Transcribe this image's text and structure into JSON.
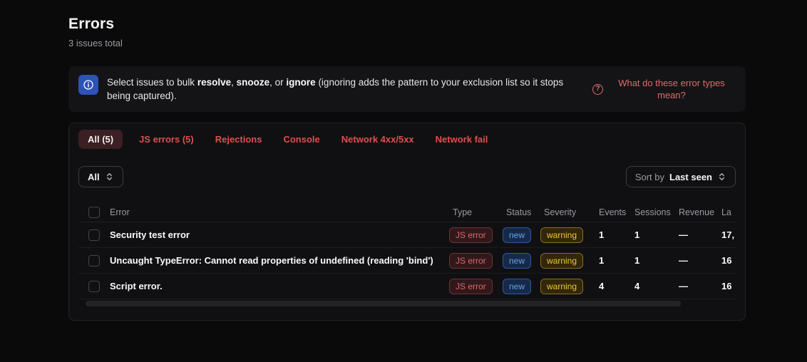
{
  "page": {
    "title": "Errors",
    "subtitle": "3 issues total"
  },
  "banner": {
    "text_parts": {
      "p1": "Select issues to bulk ",
      "b1": "resolve",
      "p2": ", ",
      "b2": "snooze",
      "p3": ", or ",
      "b3": "ignore",
      "p4": " (ignoring adds the pattern to your exclusion list so it stops being captured)."
    },
    "help_link": "What do these error types mean?"
  },
  "icons": {
    "help": "?"
  },
  "tabs": [
    {
      "label": "All (5)",
      "active": true
    },
    {
      "label": "JS errors (5)",
      "active": false
    },
    {
      "label": "Rejections",
      "active": false
    },
    {
      "label": "Console",
      "active": false
    },
    {
      "label": "Network 4xx/5xx",
      "active": false
    },
    {
      "label": "Network fail",
      "active": false
    }
  ],
  "filters": {
    "scope": "All",
    "sort_label": "Sort by",
    "sort_value": "Last seen"
  },
  "table": {
    "columns": [
      "Error",
      "Type",
      "Status",
      "Severity",
      "Events",
      "Sessions",
      "Revenue",
      "La"
    ],
    "rows": [
      {
        "error": "Security test error",
        "type": "JS error",
        "status": "new",
        "severity": "warning",
        "events": "1",
        "sessions": "1",
        "revenue": "—",
        "last_seen": "17,"
      },
      {
        "error": "Uncaught TypeError: Cannot read properties of undefined (reading 'bind')",
        "type": "JS error",
        "status": "new",
        "severity": "warning",
        "events": "1",
        "sessions": "1",
        "revenue": "—",
        "last_seen": "16"
      },
      {
        "error": "Script error.",
        "type": "JS error",
        "status": "new",
        "severity": "warning",
        "events": "4",
        "sessions": "4",
        "revenue": "—",
        "last_seen": "16"
      }
    ]
  },
  "colors": {
    "tab_red": "#e14e4e",
    "link_red": "#e06a6a",
    "info_blue": "#2d52b8",
    "badge_error_text": "#e0666c",
    "badge_new_text": "#66a3e0",
    "badge_warning_text": "#edc63e"
  }
}
